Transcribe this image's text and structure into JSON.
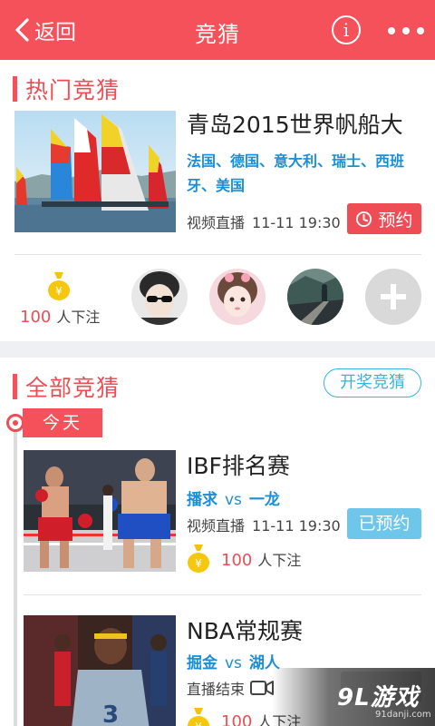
{
  "header": {
    "back_label": "返回",
    "title": "竞猜",
    "info_label": "i",
    "bg_color": "#f4515b"
  },
  "hot": {
    "section_title": "热门竞猜",
    "event": {
      "title": "青岛2015世界帆船大",
      "teams": "法国、德国、意大利、瑞士、西班牙、美国",
      "broadcast": "视频直播",
      "time": "11-11  19:30",
      "button_label": "预约",
      "button_icon": "clock-icon"
    },
    "bets": {
      "count": "100",
      "suffix": "人下注",
      "icon": "money-bag-icon"
    },
    "avatars": [
      "avatar-sunglasses",
      "avatar-girl",
      "avatar-landscape"
    ],
    "add_icon": "plus-icon"
  },
  "all": {
    "section_title": "全部竞猜",
    "draw_button": "开奖竞猜",
    "date_label": "今天",
    "events": [
      {
        "title": "IBF排名赛",
        "team_a": "播求",
        "vs": "vs",
        "team_b": "一龙",
        "broadcast": "视频直播",
        "time": "11-11  19:30",
        "button_label": "已预约",
        "bet_count": "100",
        "bet_suffix": "人下注"
      },
      {
        "title": "NBA常规赛",
        "team_a": "掘金",
        "vs": "vs",
        "team_b": "湖人",
        "broadcast": "直播结束",
        "bet_count": "100",
        "bet_suffix": "人下注"
      }
    ]
  },
  "watermark": {
    "main": "9L游戏",
    "sub": "91danji.com"
  },
  "colors": {
    "accent": "#ee4d55",
    "link": "#1a8fd8",
    "reserved": "#6ec6ea",
    "outline": "#38b4de"
  }
}
